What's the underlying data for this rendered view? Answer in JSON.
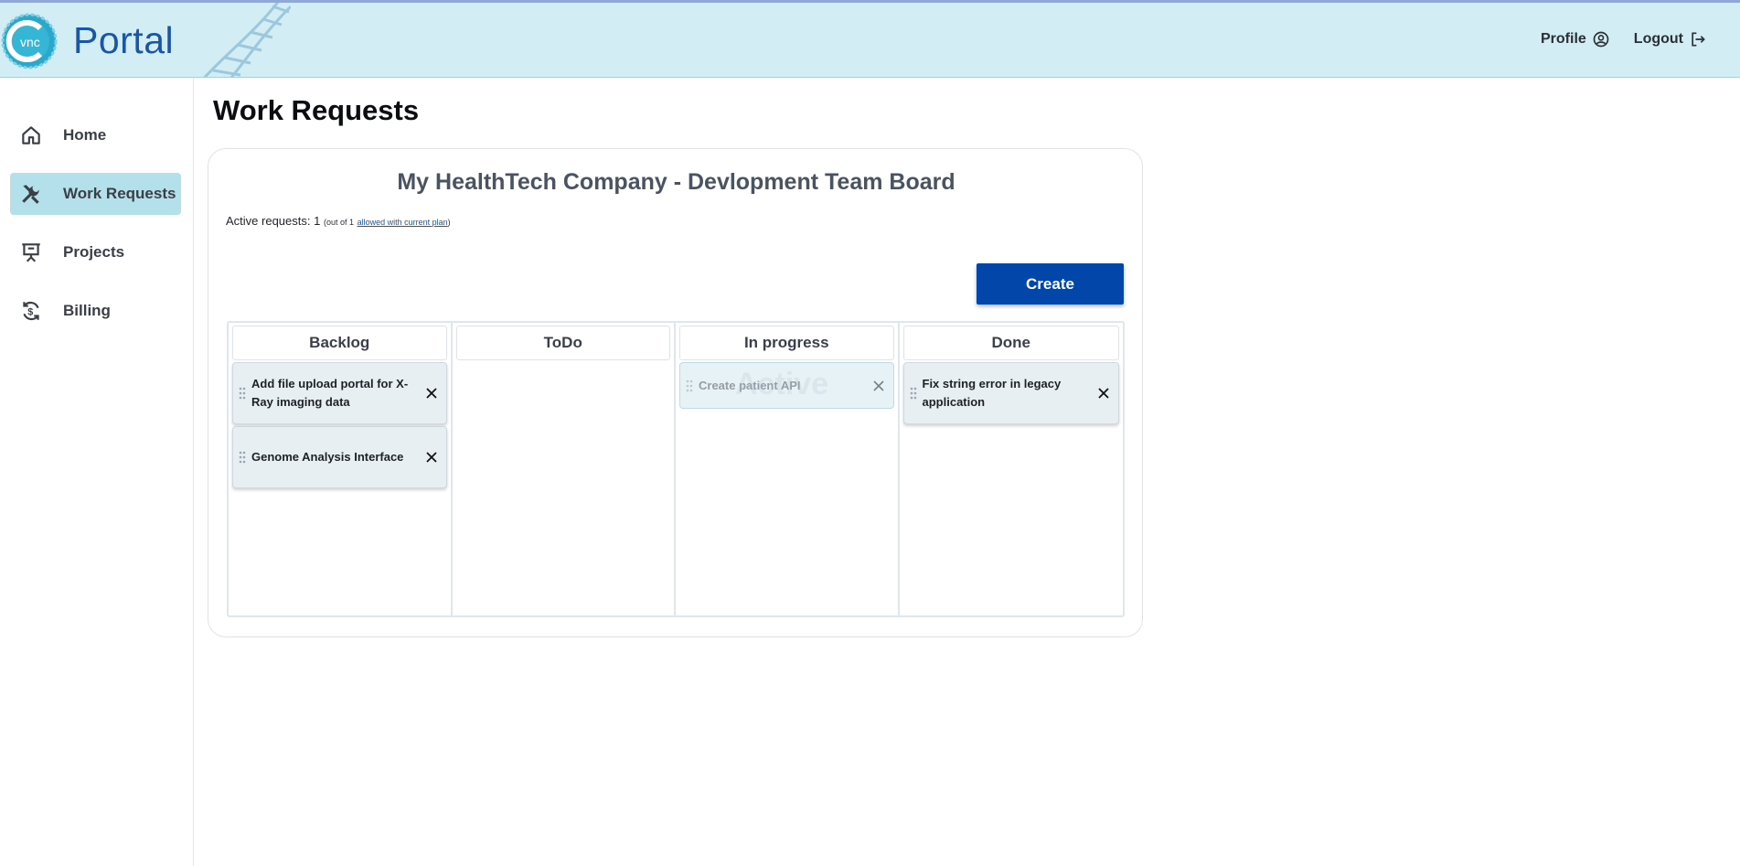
{
  "header": {
    "logo_text": "vnc",
    "brand": "Portal",
    "profile_label": "Profile",
    "logout_label": "Logout"
  },
  "sidebar": {
    "items": [
      {
        "label": "Home",
        "icon": "home-icon",
        "active": false
      },
      {
        "label": "Work Requests",
        "icon": "tools-icon",
        "active": true
      },
      {
        "label": "Projects",
        "icon": "presentation-board-icon",
        "active": false
      },
      {
        "label": "Billing",
        "icon": "dollar-cycle-icon",
        "active": false
      }
    ]
  },
  "main": {
    "page_title": "Work Requests",
    "board_title": "My HealthTech Company - Devlopment Team Board",
    "active_requests": {
      "label": "Active requests: 1",
      "limit_text": "(out of 1",
      "link_text": "allowed with current plan",
      "close_paren": ")"
    },
    "create_label": "Create",
    "columns": [
      {
        "title": "Backlog",
        "tasks": [
          "Add file upload portal for X-Ray imaging data",
          "Genome Analysis Interface"
        ]
      },
      {
        "title": "ToDo",
        "tasks": []
      },
      {
        "title": "In progress",
        "tasks": [
          "Create patient API"
        ],
        "watermark": "Active"
      },
      {
        "title": "Done",
        "tasks": [
          "Fix string error in legacy application"
        ]
      }
    ]
  },
  "colors": {
    "header_bg": "#d3edf4",
    "brand": "#1a56a8",
    "accent": "#0346aa",
    "active_nav": "#b3e0ea"
  }
}
